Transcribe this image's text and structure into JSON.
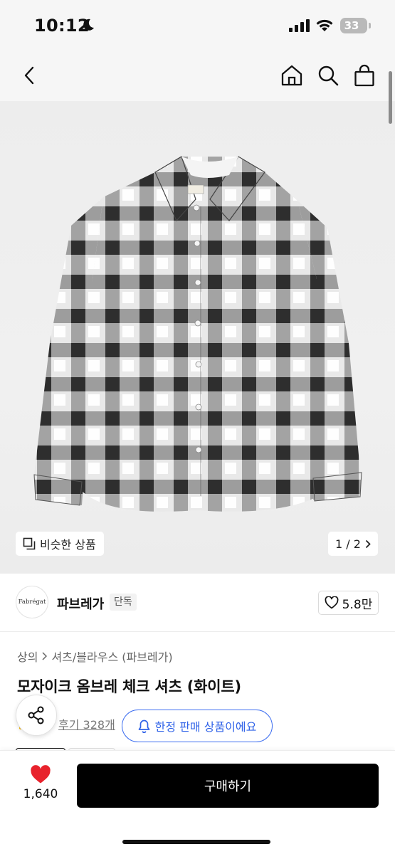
{
  "status": {
    "time": "10:12",
    "battery": "33"
  },
  "icons": {
    "back": "chevron-left-icon",
    "home": "home-icon",
    "search": "search-icon",
    "bag": "shopping-bag-icon",
    "similar": "copy-icon",
    "heart": "heart-icon",
    "share": "share-icon",
    "bell": "bell-icon"
  },
  "gallery": {
    "similar_label": "비슷한 상품",
    "counter": "1 / 2",
    "logo_text": "Fabrégat"
  },
  "brand": {
    "logo_text": "Fabrégat",
    "name": "파브레가",
    "badge": "단독",
    "likes": "5.8만"
  },
  "product": {
    "breadcrumb": [
      "상의",
      "셔츠/블라우스 (파브레가)"
    ],
    "title": "모자이크 옴브레 체크 셔츠 (화이트)",
    "reviews": "후기 328개",
    "limited_label": "한정 판매 상품이에요"
  },
  "bottom": {
    "wish_count": "1,640",
    "buy_label": "구매하기"
  },
  "colors": {
    "accent_blue": "#2f62e8",
    "heart_red": "#e8222c",
    "buy_black": "#000000"
  }
}
